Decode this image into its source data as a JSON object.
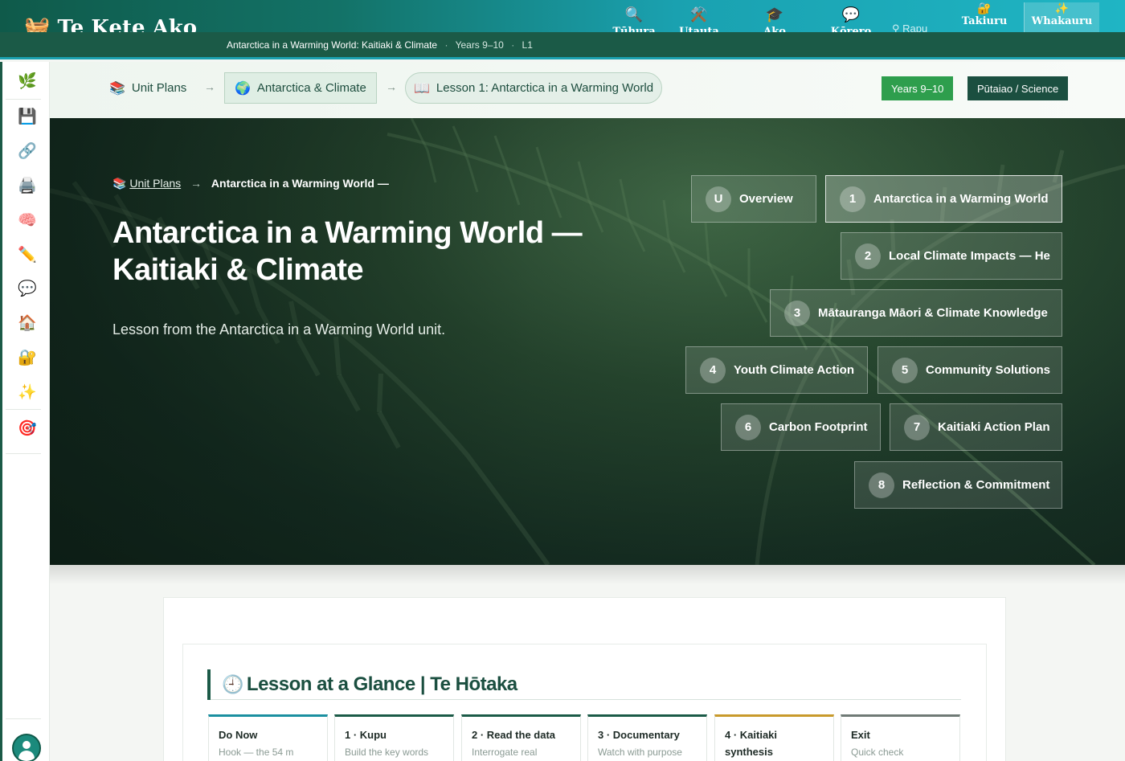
{
  "topnav": {
    "brand": "Te Kete Ako",
    "items": [
      {
        "icon": "🔍",
        "label": "Tūhura"
      },
      {
        "icon": "⚒️",
        "label": "Utauta"
      },
      {
        "icon": "🎓",
        "label": "Ako"
      },
      {
        "icon": "💬",
        "label": "Kōrero"
      }
    ],
    "search_label": "Rapu",
    "login_icon": "🔐",
    "login_label": "Takiuru",
    "signup_icon": "✨",
    "signup_label": "Whakauru"
  },
  "context": {
    "unit": "Antarctica in a Warming World: Kaitiaki & Climate",
    "years": "Years 9–10",
    "lesson": "L1"
  },
  "rail": {
    "icons": [
      "🌿",
      "💾",
      "🔗",
      "🖨️",
      "🧠",
      "✏️",
      "💬",
      "🏠",
      "🔐",
      "✨",
      "🎯"
    ]
  },
  "breadcrumb": {
    "unit_plans_icon": "📚",
    "unit_plans": "Unit Plans",
    "unit_icon": "🌍",
    "unit": "Antarctica & Climate",
    "lesson_icon": "📖",
    "lesson": "Lesson 1: Antarctica in a Warming World",
    "arrow": "→",
    "years_tag": "Years 9–10",
    "subject_tag": "Pūtaiao / Science"
  },
  "hero": {
    "crumb_icon": "📚",
    "crumb_link": "Unit Plans",
    "crumb_sep": "→",
    "crumb_current": "Antarctica in a Warming World —",
    "title": "Antarctica in a Warming World — Kaitiaki & Climate",
    "subtitle": "Lesson from the Antarctica in a Warming World unit.",
    "lessons": [
      {
        "num": "U",
        "label": "Overview",
        "active": false
      },
      {
        "num": "1",
        "label": "Antarctica in a Warming World",
        "active": true
      },
      {
        "num": "2",
        "label": "Local Climate Impacts — He",
        "active": false
      },
      {
        "num": "3",
        "label": "Mātauranga Māori & Climate Knowledge",
        "active": false
      },
      {
        "num": "4",
        "label": "Youth Climate Action",
        "active": false
      },
      {
        "num": "5",
        "label": "Community Solutions",
        "active": false
      },
      {
        "num": "6",
        "label": "Carbon Footprint",
        "active": false
      },
      {
        "num": "7",
        "label": "Kaitiaki Action Plan",
        "active": false
      },
      {
        "num": "8",
        "label": "Reflection & Commitment",
        "active": false
      }
    ]
  },
  "glance": {
    "icon": "🕘",
    "title": "Lesson at a Glance | Te Hōtaka",
    "steps": [
      {
        "title": "Do Now",
        "desc": "Hook — the 54 m"
      },
      {
        "title": "1 · Kupu",
        "desc": "Build the key words"
      },
      {
        "title": "2 · Read the data",
        "desc": "Interrogate real"
      },
      {
        "title": "3 · Documentary",
        "desc": "Watch with purpose"
      },
      {
        "title": "4 · Kaitiaki synthesis",
        "desc": ""
      },
      {
        "title": "Exit",
        "desc": "Quick check"
      }
    ]
  }
}
